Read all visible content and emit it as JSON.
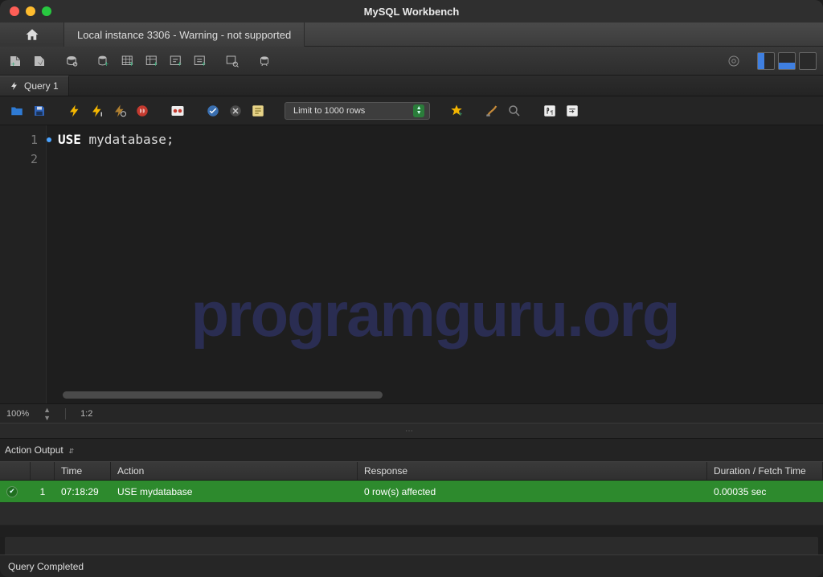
{
  "window": {
    "title": "MySQL Workbench"
  },
  "conn_tabs": {
    "home": "",
    "connection_label": "Local instance 3306 - Warning - not supported"
  },
  "query_tabs": [
    {
      "label": "Query 1"
    }
  ],
  "editor_toolbar": {
    "limit_label": "Limit to 1000 rows"
  },
  "code": {
    "lines": [
      {
        "n": "1",
        "keyword": "USE",
        "rest": " mydatabase;"
      },
      {
        "n": "2",
        "keyword": "",
        "rest": ""
      }
    ]
  },
  "watermark": "programguru.org",
  "editor_footer": {
    "zoom": "100%",
    "pos": "1:2"
  },
  "output": {
    "selector_label": "Action Output",
    "columns": {
      "time": "Time",
      "action": "Action",
      "response": "Response",
      "duration": "Duration / Fetch Time"
    },
    "rows": [
      {
        "idx": "1",
        "time": "07:18:29",
        "action": "USE mydatabase",
        "response": "0 row(s) affected",
        "duration": "0.00035 sec"
      }
    ]
  },
  "statusbar": {
    "text": "Query Completed"
  }
}
